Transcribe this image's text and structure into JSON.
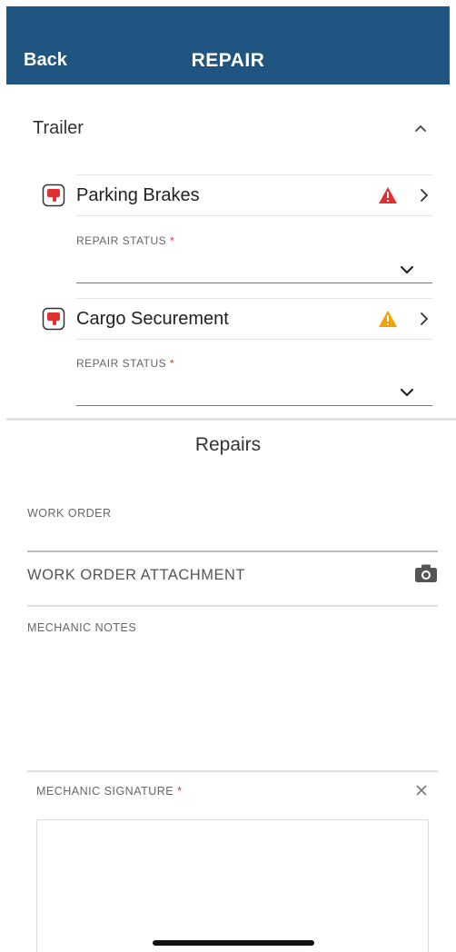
{
  "header": {
    "back_label": "Back",
    "title": "REPAIR"
  },
  "section": {
    "title": "Trailer"
  },
  "items": [
    {
      "name": "Parking Brakes",
      "status_label": "REPAIR STATUS",
      "required": "*",
      "warning_color": "#e03131"
    },
    {
      "name": "Cargo Securement",
      "status_label": "REPAIR STATUS",
      "required": "*",
      "warning_color": "#f59f00"
    }
  ],
  "repairs": {
    "title": "Repairs",
    "work_order_label": "WORK ORDER",
    "attachment_label": "WORK ORDER ATTACHMENT",
    "mechanic_notes_label": "MECHANIC NOTES",
    "signature_label": "MECHANIC SIGNATURE",
    "signature_required": "*"
  },
  "colors": {
    "header_bg": "#1f5580",
    "required": "#e03131"
  },
  "icons": {
    "collapse": "chevron-up-icon",
    "defect": "thumbs-down-icon",
    "warning": "warning-triangle-icon",
    "navigate": "chevron-right-icon",
    "dropdown": "chevron-down-icon",
    "camera": "camera-icon",
    "clear": "close-icon"
  }
}
